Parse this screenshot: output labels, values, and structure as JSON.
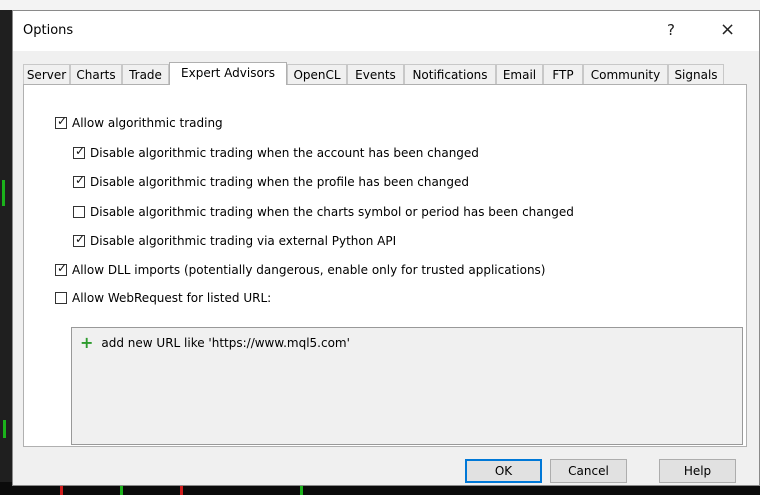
{
  "dialog": {
    "title": "Options",
    "help_glyph": "?",
    "close_glyph": "×"
  },
  "tabs": [
    {
      "label": "Server"
    },
    {
      "label": "Charts"
    },
    {
      "label": "Trade"
    },
    {
      "label": "Expert Advisors",
      "active": true
    },
    {
      "label": "OpenCL"
    },
    {
      "label": "Events"
    },
    {
      "label": "Notifications"
    },
    {
      "label": "Email"
    },
    {
      "label": "FTP"
    },
    {
      "label": "Community"
    },
    {
      "label": "Signals"
    }
  ],
  "options": {
    "allow_algo": {
      "label": "Allow algorithmic trading",
      "checked": true
    },
    "disable_account": {
      "label": "Disable algorithmic trading when the account has been changed",
      "checked": true
    },
    "disable_profile": {
      "label": "Disable algorithmic trading when the profile has been changed",
      "checked": true
    },
    "disable_symbol": {
      "label": "Disable algorithmic trading when the charts symbol or period has been changed",
      "checked": false
    },
    "disable_python": {
      "label": "Disable algorithmic trading via external Python API",
      "checked": true
    },
    "allow_dll": {
      "label": "Allow DLL imports (potentially dangerous, enable only for trusted applications)",
      "checked": true
    },
    "allow_webrequest": {
      "label": "Allow WebRequest for listed URL:",
      "checked": false
    }
  },
  "url_list": {
    "add_label": "add new URL like 'https://www.mql5.com'"
  },
  "buttons": {
    "ok": "OK",
    "cancel": "Cancel",
    "help": "Help"
  },
  "check_glyph": "✓"
}
